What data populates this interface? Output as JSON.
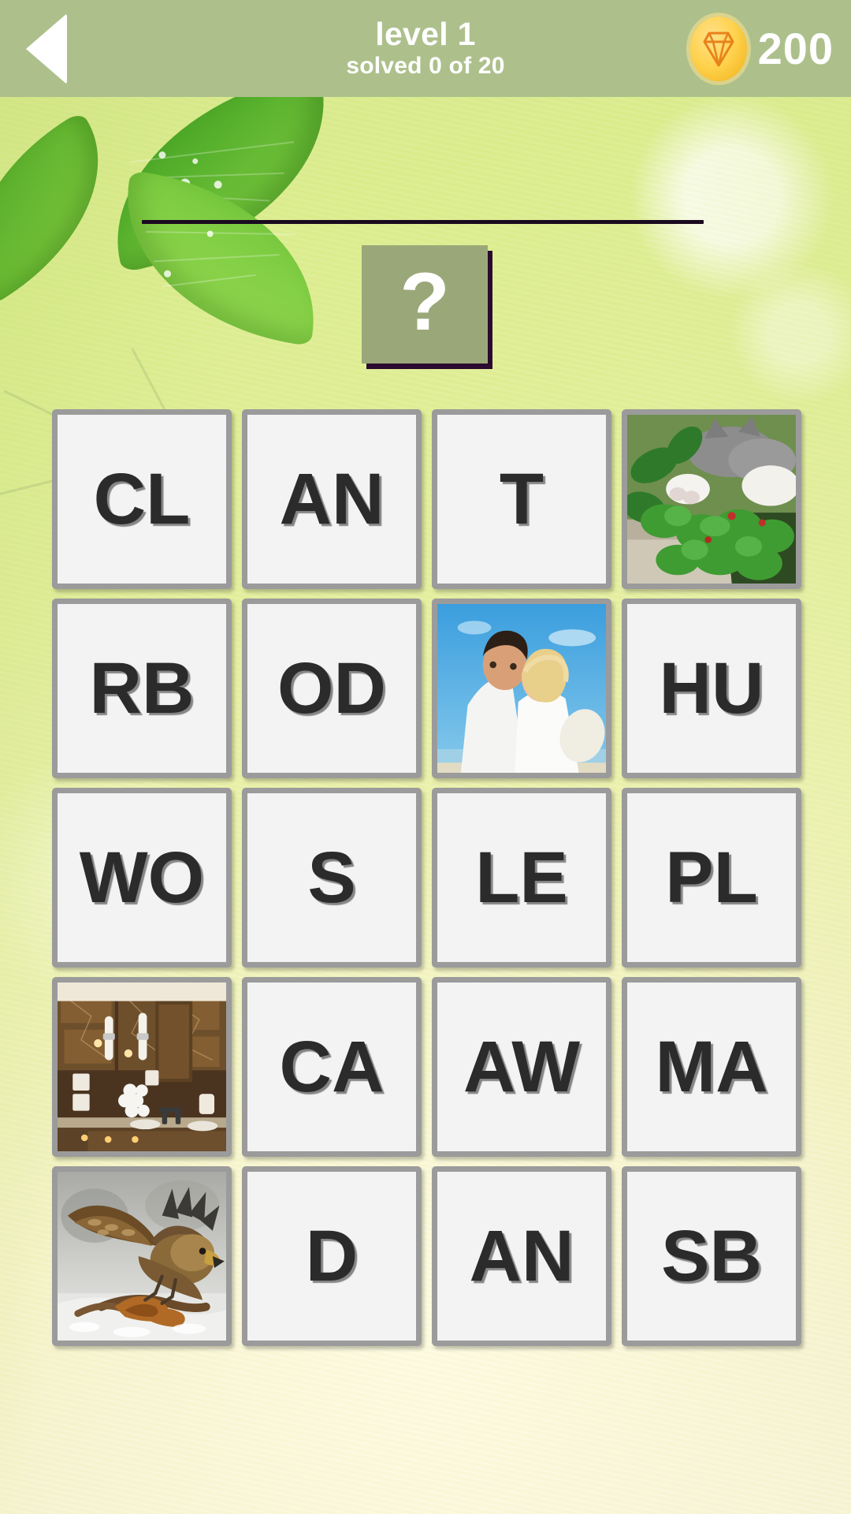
{
  "app": {
    "screen_name": "word-puzzle-level"
  },
  "header": {
    "back_icon": "back-arrow-icon",
    "level_label": "level 1",
    "progress_label": "solved 0 of 20",
    "gem_icon": "gem-icon",
    "gem_count": "200",
    "background_color": "#adc08c",
    "text_color": "#ffffff"
  },
  "answer": {
    "slot_line_color": "#1a0a1f",
    "question_tile": {
      "glyph": "?",
      "background_color": "#9aa879",
      "shadow_color": "#2a0a2e"
    }
  },
  "grid": {
    "columns": 4,
    "rows": 5,
    "tile_border_color": "#9b9b9b",
    "tile_fill_color": "#f3f3f3",
    "tile_text_color": "#2b2b2b",
    "tiles": [
      {
        "type": "letter",
        "label": "CL",
        "name": "tile-letter-cl"
      },
      {
        "type": "letter",
        "label": "AN",
        "name": "tile-letter-an-1"
      },
      {
        "type": "letter",
        "label": "T",
        "name": "tile-letter-t"
      },
      {
        "type": "photo",
        "label": "",
        "name": "tile-photo-cat",
        "photo": "cat-in-planter"
      },
      {
        "type": "letter",
        "label": "RB",
        "name": "tile-letter-rb"
      },
      {
        "type": "letter",
        "label": "OD",
        "name": "tile-letter-od"
      },
      {
        "type": "photo",
        "label": "",
        "name": "tile-photo-couple",
        "photo": "couple-on-beach"
      },
      {
        "type": "letter",
        "label": "HU",
        "name": "tile-letter-hu"
      },
      {
        "type": "letter",
        "label": "WO",
        "name": "tile-letter-wo"
      },
      {
        "type": "letter",
        "label": "S",
        "name": "tile-letter-s"
      },
      {
        "type": "letter",
        "label": "LE",
        "name": "tile-letter-le"
      },
      {
        "type": "letter",
        "label": "PL",
        "name": "tile-letter-pl"
      },
      {
        "type": "photo",
        "label": "",
        "name": "tile-photo-bathroom",
        "photo": "marble-bathroom"
      },
      {
        "type": "letter",
        "label": "CA",
        "name": "tile-letter-ca"
      },
      {
        "type": "letter",
        "label": "AW",
        "name": "tile-letter-aw"
      },
      {
        "type": "letter",
        "label": "MA",
        "name": "tile-letter-ma"
      },
      {
        "type": "photo",
        "label": "",
        "name": "tile-photo-eagle",
        "photo": "eagle-in-snow"
      },
      {
        "type": "letter",
        "label": "D",
        "name": "tile-letter-d"
      },
      {
        "type": "letter",
        "label": "AN",
        "name": "tile-letter-an-2"
      },
      {
        "type": "letter",
        "label": "SB",
        "name": "tile-letter-sb"
      }
    ]
  },
  "background": {
    "theme": "green-leaves",
    "top_color": "#d7e88a",
    "bottom_color": "#f8f4d8"
  }
}
